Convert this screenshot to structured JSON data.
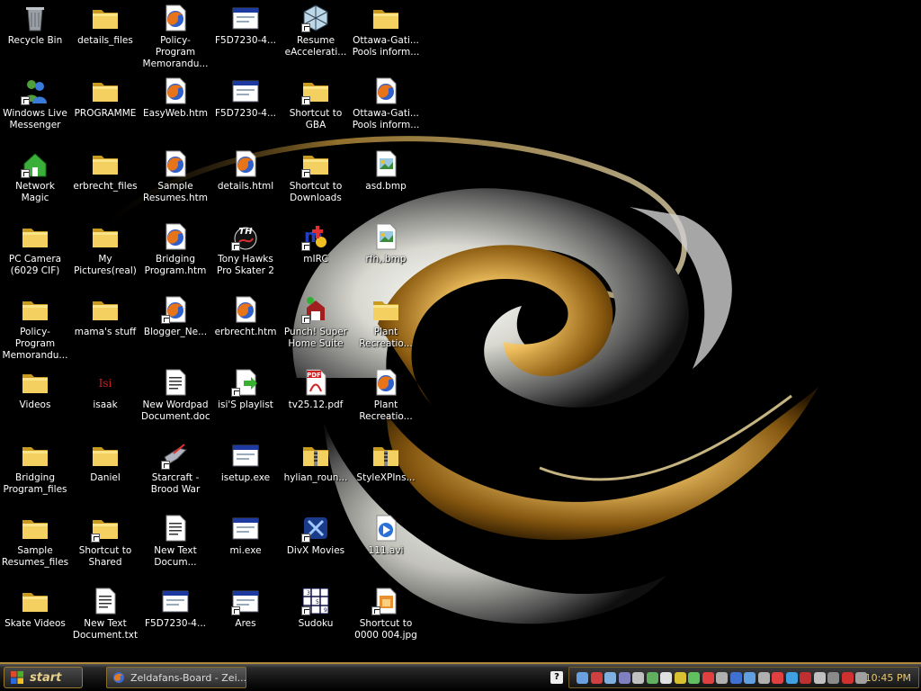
{
  "desktop": {
    "icons": [
      {
        "label": "Recycle Bin",
        "type": "recycle",
        "icon": "recycle-bin-icon"
      },
      {
        "label": "Windows Live\nMessenger",
        "type": "messenger",
        "icon": "messenger-icon",
        "shortcut": true
      },
      {
        "label": "Network Magic",
        "type": "house",
        "icon": "network-magic-icon",
        "shortcut": true
      },
      {
        "label": "PC Camera\n(6029 CIF)",
        "type": "folder",
        "icon": "folder-icon"
      },
      {
        "label": "Policy-Program\nMemorandu...",
        "type": "folder",
        "icon": "folder-icon"
      },
      {
        "label": "Videos",
        "type": "folder",
        "icon": "folder-icon"
      },
      {
        "label": "Bridging\nProgram_files",
        "type": "folder",
        "icon": "folder-icon"
      },
      {
        "label": "Sample\nResumes_files",
        "type": "folder",
        "icon": "folder-icon"
      },
      {
        "label": "Skate Videos",
        "type": "folder",
        "icon": "folder-icon"
      },
      {
        "label": "details_files",
        "type": "folder",
        "icon": "folder-icon"
      },
      {
        "label": "PROGRAMME",
        "type": "folder",
        "icon": "folder-icon"
      },
      {
        "label": "erbrecht_files",
        "type": "folder",
        "icon": "folder-icon"
      },
      {
        "label": "My\nPictures(real)",
        "type": "folder",
        "icon": "folder-icon"
      },
      {
        "label": "mama's stuff",
        "type": "folder",
        "icon": "folder-icon"
      },
      {
        "label": "isaak",
        "type": "text",
        "icon": "isaak-icon",
        "glyph_text": "Isi"
      },
      {
        "label": "Daniel",
        "type": "folder",
        "icon": "folder-icon"
      },
      {
        "label": "Shortcut to\nShared",
        "type": "folder",
        "icon": "folder-icon",
        "shortcut": true
      },
      {
        "label": "New Text\nDocument.txt",
        "type": "doc",
        "icon": "text-document-icon"
      },
      {
        "label": "Policy-Program\nMemorandu...",
        "type": "firefox",
        "icon": "firefox-document-icon"
      },
      {
        "label": "EasyWeb.htm",
        "type": "firefox",
        "icon": "firefox-document-icon"
      },
      {
        "label": "Sample\nResumes.htm",
        "type": "firefox",
        "icon": "firefox-document-icon"
      },
      {
        "label": "Bridging\nProgram.htm",
        "type": "firefox",
        "icon": "firefox-document-icon"
      },
      {
        "label": "Blogger_Ne...",
        "type": "firefox",
        "icon": "firefox-document-icon",
        "shortcut": true
      },
      {
        "label": "New Wordpad\nDocument.doc",
        "type": "doc",
        "icon": "wordpad-document-icon"
      },
      {
        "label": "Starcraft -\nBrood War",
        "type": "starcraft",
        "icon": "starcraft-icon",
        "shortcut": true
      },
      {
        "label": "New Text\nDocum...",
        "type": "doc",
        "icon": "text-document-icon"
      },
      {
        "label": "F5D7230-4...",
        "type": "window",
        "icon": "web-page-icon"
      },
      {
        "label": "F5D7230-4...",
        "type": "window",
        "icon": "web-page-icon"
      },
      {
        "label": "F5D7230-4...",
        "type": "window",
        "icon": "web-page-icon"
      },
      {
        "label": "details.html",
        "type": "firefox",
        "icon": "firefox-document-icon"
      },
      {
        "label": "Tony Hawks\nPro Skater 2",
        "type": "th",
        "icon": "tony-hawk-icon",
        "shortcut": true,
        "glyph_text": "TH"
      },
      {
        "label": "erbrecht.htm",
        "type": "firefox",
        "icon": "firefox-document-icon"
      },
      {
        "label": "isi'S playlist",
        "type": "playlist",
        "icon": "playlist-icon",
        "shortcut": true
      },
      {
        "label": "isetup.exe",
        "type": "window",
        "icon": "application-icon"
      },
      {
        "label": "mi.exe",
        "type": "window",
        "icon": "application-icon"
      },
      {
        "label": "Ares",
        "type": "window",
        "icon": "application-icon",
        "shortcut": true
      },
      {
        "label": "Resume\neAccelerati...",
        "type": "globe",
        "icon": "resume-eaccelerator-icon",
        "shortcut": true
      },
      {
        "label": "Shortcut to\nGBA",
        "type": "folder",
        "icon": "folder-icon",
        "shortcut": true
      },
      {
        "label": "Shortcut to\nDownloads",
        "type": "folder",
        "icon": "folder-icon",
        "shortcut": true
      },
      {
        "label": "mIRC",
        "type": "mirc",
        "icon": "mirc-icon",
        "shortcut": true
      },
      {
        "label": "Punch! Super\nHome Suite",
        "type": "punch",
        "icon": "punch-home-icon",
        "shortcut": true
      },
      {
        "label": "tv25.12.pdf",
        "type": "pdf",
        "icon": "pdf-icon",
        "glyph_text": "PDF"
      },
      {
        "label": "hylian_roun...",
        "type": "zip",
        "icon": "zip-folder-icon"
      },
      {
        "label": "DivX Movies",
        "type": "divx",
        "icon": "divx-icon",
        "shortcut": true
      },
      {
        "label": "Sudoku",
        "type": "sudoku",
        "icon": "sudoku-icon",
        "shortcut": true
      },
      {
        "label": "Ottawa-Gati...\nPools inform...",
        "type": "folder",
        "icon": "folder-icon"
      },
      {
        "label": "Ottawa-Gati...\nPools inform...",
        "type": "firefox",
        "icon": "firefox-document-icon"
      },
      {
        "label": "asd.bmp",
        "type": "bmp",
        "icon": "bitmap-icon"
      },
      {
        "label": "rfh,.bmp",
        "type": "bmp",
        "icon": "bitmap-icon"
      },
      {
        "label": "Plant\nRecreatio...",
        "type": "folder",
        "icon": "folder-icon"
      },
      {
        "label": "Plant\nRecreatio...",
        "type": "firefox",
        "icon": "firefox-document-icon"
      },
      {
        "label": "StyleXPIns...",
        "type": "zip",
        "icon": "zip-folder-icon"
      },
      {
        "label": "111.avi",
        "type": "media",
        "icon": "video-file-icon"
      },
      {
        "label": "Shortcut to\n0000 004.jpg",
        "type": "jpg",
        "icon": "image-file-icon",
        "shortcut": true
      }
    ]
  },
  "taskbar": {
    "start_label": "start",
    "task_label": "Zeldafans-Board - Zei...",
    "clock": "10:45 PM",
    "help_label": "?",
    "tray_icon_colors": [
      "#6aa0e0",
      "#d04040",
      "#80b0e0",
      "#8080c0",
      "#c0c0c0",
      "#60b060",
      "#e0e0e0",
      "#d8c030",
      "#60c060",
      "#e04040",
      "#b0b0b0",
      "#4070d0",
      "#60a0e0",
      "#b0b0b0",
      "#e04040",
      "#40a0e0",
      "#c03030",
      "#c0c0c0",
      "#8a8a8a",
      "#d03030",
      "#a0a0a0"
    ]
  }
}
